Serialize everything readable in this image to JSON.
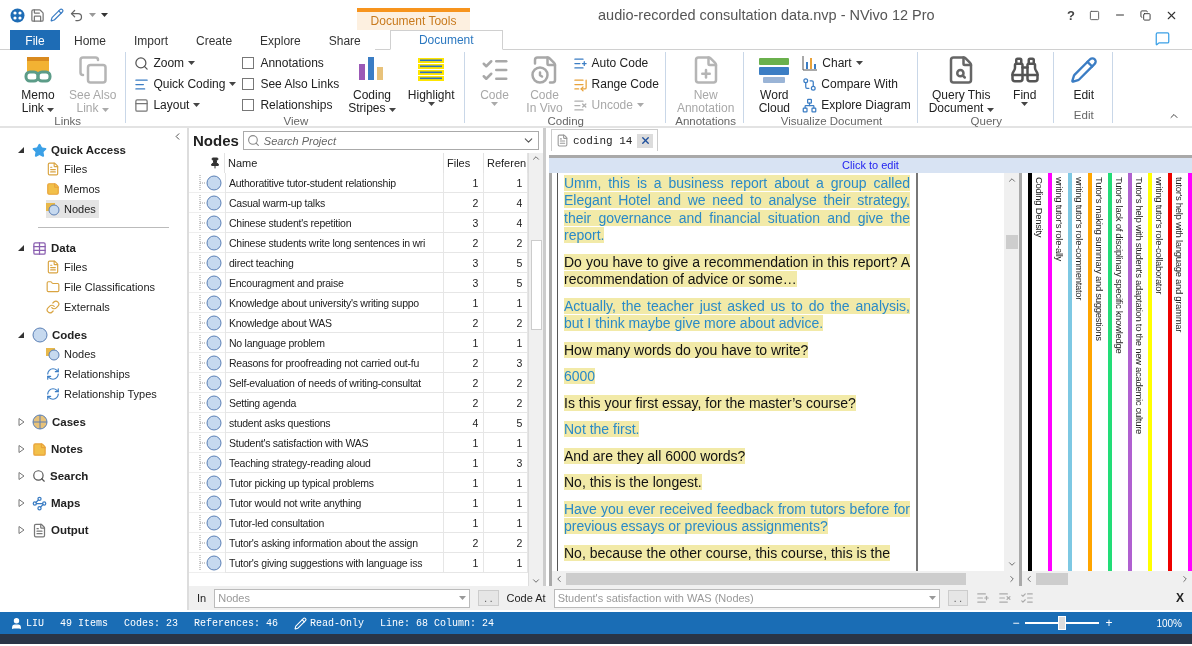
{
  "title_bar": {
    "title": "audio-recorded consultation data.nvp - NVivo 12 Pro",
    "context_tab": "Document Tools",
    "help": "?"
  },
  "tabs": [
    {
      "label": "File",
      "kind": "file",
      "selected": false
    },
    {
      "label": "Home",
      "kind": "normal",
      "selected": false
    },
    {
      "label": "Import",
      "kind": "normal",
      "selected": false
    },
    {
      "label": "Create",
      "kind": "normal",
      "selected": false
    },
    {
      "label": "Explore",
      "kind": "normal",
      "selected": false
    },
    {
      "label": "Share",
      "kind": "normal",
      "selected": false
    },
    {
      "label": "Document",
      "kind": "context",
      "selected": true
    }
  ],
  "ribbon": {
    "groups": [
      {
        "label": "Links",
        "columns": [
          {
            "kind": "large",
            "lines": [
              "Memo",
              "Link"
            ],
            "dropdown": true,
            "disabled": false
          },
          {
            "kind": "large",
            "lines": [
              "See Also",
              "Link"
            ],
            "dropdown": true,
            "disabled": true
          }
        ]
      },
      {
        "label": "View",
        "columns": [
          {
            "kind": "stack",
            "items": [
              {
                "kind": "menu",
                "label": "Zoom",
                "dropdown": true,
                "disabled": false
              },
              {
                "kind": "menu",
                "label": "Quick Coding",
                "dropdown": true,
                "disabled": false
              },
              {
                "kind": "menu",
                "label": "Layout",
                "dropdown": true,
                "disabled": false
              }
            ]
          },
          {
            "kind": "stack",
            "items": [
              {
                "kind": "check",
                "label": "Annotations",
                "checked": false
              },
              {
                "kind": "check",
                "label": "See Also Links",
                "checked": false
              },
              {
                "kind": "check",
                "label": "Relationships",
                "checked": false
              }
            ]
          },
          {
            "kind": "large",
            "lines": [
              "Coding",
              "Stripes"
            ],
            "dropdown": true,
            "disabled": false
          },
          {
            "kind": "large",
            "lines": [
              "Highlight"
            ],
            "dropdown": true,
            "disabled": false
          }
        ]
      },
      {
        "label": "Coding",
        "columns": [
          {
            "kind": "large",
            "lines": [
              "Code"
            ],
            "dropdown": true,
            "disabled": true
          },
          {
            "kind": "large",
            "lines": [
              "Code",
              "In Vivo"
            ],
            "dropdown": false,
            "disabled": true
          },
          {
            "kind": "stack",
            "items": [
              {
                "kind": "menu",
                "label": "Auto Code",
                "dropdown": false,
                "disabled": false
              },
              {
                "kind": "menu",
                "label": "Range Code",
                "dropdown": false,
                "disabled": false
              },
              {
                "kind": "menu",
                "label": "Uncode",
                "dropdown": true,
                "disabled": true
              }
            ]
          }
        ]
      },
      {
        "label": "Annotations",
        "columns": [
          {
            "kind": "large",
            "lines": [
              "New",
              "Annotation"
            ],
            "dropdown": false,
            "disabled": true
          }
        ]
      },
      {
        "label": "Visualize Document",
        "columns": [
          {
            "kind": "large",
            "lines": [
              "Word",
              "Cloud"
            ],
            "dropdown": false,
            "disabled": false
          },
          {
            "kind": "stack",
            "items": [
              {
                "kind": "menu",
                "label": "Chart",
                "dropdown": true,
                "disabled": false
              },
              {
                "kind": "menu",
                "label": "Compare With",
                "dropdown": false,
                "disabled": false
              },
              {
                "kind": "menu",
                "label": "Explore Diagram",
                "dropdown": false,
                "disabled": false
              }
            ]
          }
        ]
      },
      {
        "label": "Query",
        "columns": [
          {
            "kind": "large",
            "lines": [
              "Query This",
              "Document"
            ],
            "dropdown": true,
            "disabled": false
          },
          {
            "kind": "large",
            "lines": [
              "Find"
            ],
            "dropdown": true,
            "disabled": false
          }
        ]
      },
      {
        "label": "Edit",
        "columns": [
          {
            "kind": "large",
            "lines": [
              "Edit"
            ],
            "dropdown": false,
            "disabled": false
          }
        ]
      }
    ]
  },
  "nav": {
    "sections": [
      {
        "label": "Quick Access",
        "expanded": true,
        "children": [
          {
            "label": "Files",
            "selected": false
          },
          {
            "label": "Memos",
            "selected": false
          },
          {
            "label": "Nodes",
            "selected": true
          }
        ]
      },
      {
        "label": "Data",
        "expanded": true,
        "children": [
          {
            "label": "Files",
            "selected": false
          },
          {
            "label": "File Classifications",
            "selected": false
          },
          {
            "label": "Externals",
            "selected": false
          }
        ]
      },
      {
        "label": "Codes",
        "expanded": true,
        "children": [
          {
            "label": "Nodes",
            "selected": false
          },
          {
            "label": "Relationships",
            "selected": false
          },
          {
            "label": "Relationship Types",
            "selected": false
          }
        ]
      },
      {
        "label": "Cases",
        "expanded": false
      },
      {
        "label": "Notes",
        "expanded": false
      },
      {
        "label": "Search",
        "expanded": false
      },
      {
        "label": "Maps",
        "expanded": false
      },
      {
        "label": "Output",
        "expanded": false
      }
    ]
  },
  "nodes_panel": {
    "title": "Nodes",
    "search": {
      "placeholder": "Search Project"
    },
    "columns": [
      "Name",
      "Files",
      "Referen"
    ],
    "rows": [
      {
        "name": "Authoratitive tutor-student relationship",
        "files": "1",
        "references": "1"
      },
      {
        "name": "Casual warm-up talks",
        "files": "2",
        "references": "4"
      },
      {
        "name": "Chinese student's repetition",
        "files": "3",
        "references": "4"
      },
      {
        "name": "Chinese students write long sentences in wri",
        "files": "2",
        "references": "2"
      },
      {
        "name": "direct teaching",
        "files": "3",
        "references": "5"
      },
      {
        "name": "Encouragment and praise",
        "files": "3",
        "references": "5"
      },
      {
        "name": "Knowledge about university's writing suppo",
        "files": "1",
        "references": "1"
      },
      {
        "name": "Knowledge about WAS",
        "files": "2",
        "references": "2"
      },
      {
        "name": "No language problem",
        "files": "1",
        "references": "1"
      },
      {
        "name": "Reasons for proofreading not carried out-fu",
        "files": "2",
        "references": "3"
      },
      {
        "name": "Self-evaluation of needs of writing-consultat",
        "files": "2",
        "references": "2"
      },
      {
        "name": "Setting agenda",
        "files": "2",
        "references": "2"
      },
      {
        "name": "student asks questions",
        "files": "4",
        "references": "5"
      },
      {
        "name": "Student's satisfaction with WAS",
        "files": "1",
        "references": "1"
      },
      {
        "name": "Teaching strategy-reading aloud",
        "files": "1",
        "references": "3"
      },
      {
        "name": "Tutor picking up typical problems",
        "files": "1",
        "references": "1"
      },
      {
        "name": "Tutor would not write anything",
        "files": "1",
        "references": "1"
      },
      {
        "name": "Tutor-led consultation",
        "files": "1",
        "references": "1"
      },
      {
        "name": "Tutor's asking information about the assign",
        "files": "2",
        "references": "2"
      },
      {
        "name": "Tutor's giving suggestions with language iss",
        "files": "1",
        "references": "1"
      }
    ]
  },
  "document": {
    "tab": {
      "label": "coding 14"
    },
    "edit_bar": "Click to edit",
    "paragraphs": [
      {
        "text": "Umm, this is a business report about a group called Elegant Hotel and we need to analyse their strategy, their governance and financial situation and give the report.",
        "kind": "accent"
      },
      {
        "text": "Do you have to give a recommendation in this report? A recommendation of advice or some…",
        "kind": "plain"
      },
      {
        "text": "Actually, the teacher just asked us to do the analysis, but I think maybe give more about advice.",
        "kind": "accent"
      },
      {
        "text": "How many words do you have to write?",
        "kind": "plain"
      },
      {
        "text": "6000",
        "kind": "accent"
      },
      {
        "text": "Is this your first essay, for the master’s course?",
        "kind": "plain"
      },
      {
        "text": "Not the first.",
        "kind": "accent"
      },
      {
        "text": "And are they all 6000 words?",
        "kind": "plain"
      },
      {
        "text": "No, this is the longest.",
        "kind": "plain"
      },
      {
        "text": "Have you ever received feedback from tutors before for previous essays or previous assignments?",
        "kind": "accent"
      },
      {
        "text": "No, because the other course, this course, this is the",
        "kind": "plain"
      }
    ],
    "stripes": [
      {
        "label": "Coding Density",
        "color": "#000000"
      },
      {
        "label": "writing tutor's role-ally",
        "color": "#ff00ff"
      },
      {
        "label": "writing tutor's role-commentator",
        "color": "#7ec8e3"
      },
      {
        "label": "Tutor's making summary and suggestions",
        "color": "#ffa500"
      },
      {
        "label": "Tutor's lack of disciplinary specific knowledge",
        "color": "#22dd77"
      },
      {
        "label": "Tutor's help with student's adaptation to the new academic culture",
        "color": "#b060d0"
      },
      {
        "label": "writing tutor's role-collaborator",
        "color": "#ffff00"
      },
      {
        "label": "tutor's help with language and grammar",
        "color": "#ee0000"
      },
      {
        "color": "#ff00ff"
      }
    ]
  },
  "code_at_bar": {
    "in_label": "In",
    "in_value": "Nodes",
    "in_browse": ". .",
    "code_at_label": "Code At",
    "code_at_value": "Student's satisfaction with WAS (Nodes)",
    "code_at_browse": ". .",
    "close": "X"
  },
  "status_bar": {
    "user": "LIU",
    "items": "49 Items",
    "codes": "Codes: 23",
    "references": "References: 46",
    "mode": "Read-Only",
    "position": "Line: 68 Column: 24",
    "zoom": {
      "minus": "−",
      "plus": "+",
      "level": 0.5,
      "reading": "100%"
    }
  }
}
